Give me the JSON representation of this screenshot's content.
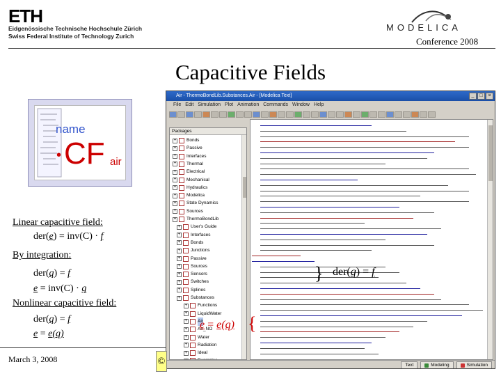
{
  "header": {
    "eth_logo_text": "ETH",
    "eth_line1": "Eidgenössische Technische Hochschule Zürich",
    "eth_line2": "Swiss Federal Institute of Technology Zurich",
    "modelica_logo_text": "MODELICA",
    "conference": "Conference 2008"
  },
  "slide": {
    "title": "Capacitive Fields",
    "date": "March 3, 2008",
    "copyright_glyph": "©"
  },
  "cf_icon": {
    "name_label": "name",
    "bullet": "•",
    "main": "CF",
    "subscript": "air"
  },
  "left_text": {
    "linear_heading": "Linear capacitive field:",
    "linear_eq_prefix": "der(",
    "linear_eq_var": "e",
    "linear_eq_mid": ") = inv(C) · ",
    "linear_eq_f": "f",
    "integration_heading": "By integration:",
    "int_eq1_prefix": "der(",
    "int_eq1_var": "q",
    "int_eq1_mid": ") = ",
    "int_eq1_f": "f",
    "int_eq2_e": "e",
    "int_eq2_mid": " = inv(C) · ",
    "int_eq2_q": "q",
    "nonlinear_heading": "Nonlinear capacitive field:",
    "nl_eq1_prefix": "der(",
    "nl_eq1_var": "q",
    "nl_eq1_mid": ") = ",
    "nl_eq1_f": "f",
    "nl_eq2_e": "e",
    "nl_eq2_mid": " = ",
    "nl_eq2_fn": "e(q)"
  },
  "overlay": {
    "brace_right": "}",
    "right_eq_prefix": "der(",
    "right_eq_var": "q",
    "right_eq_mid": ") = ",
    "right_eq_f": "f",
    "red_eq_e": "e",
    "red_eq_mid": " = ",
    "red_eq_fn": "e(q)",
    "brace_left": "{"
  },
  "window": {
    "title": "Air - ThermoBondLib.Substances.Air - [Modelica Text]",
    "buttons": [
      "_",
      "□",
      "×"
    ],
    "menu": [
      "File",
      "Edit",
      "Simulation",
      "Plot",
      "Animation",
      "Commands",
      "Window",
      "Help"
    ],
    "packages_header": "Packages",
    "packages": [
      {
        "label": "Bonds",
        "selected": false
      },
      {
        "label": "Passive",
        "selected": false
      },
      {
        "label": "Interfaces",
        "selected": false
      },
      {
        "label": "Thermal",
        "selected": false
      },
      {
        "label": "Electrical",
        "selected": false
      },
      {
        "label": "Mechanical",
        "selected": false
      },
      {
        "label": "Hydraulics",
        "selected": false
      },
      {
        "label": "Modelica",
        "selected": false
      },
      {
        "label": "State Dynamics",
        "selected": false
      },
      {
        "label": "Sources",
        "selected": false
      },
      {
        "label": "ThermoBondLib",
        "selected": false
      },
      {
        "label": "User's Guide",
        "selected": false
      },
      {
        "label": "Interfaces",
        "selected": false
      },
      {
        "label": "Bonds",
        "selected": false
      },
      {
        "label": "Junctions",
        "selected": false
      },
      {
        "label": "Passive",
        "selected": false
      },
      {
        "label": "Sources",
        "selected": false
      },
      {
        "label": "Sensors",
        "selected": false
      },
      {
        "label": "Switches",
        "selected": false
      },
      {
        "label": "Splines",
        "selected": false
      },
      {
        "label": "Substances",
        "selected": false
      },
      {
        "label": "Functions",
        "selected": false
      },
      {
        "label": "LiquidWater",
        "selected": false
      },
      {
        "label": "Air",
        "selected": true
      },
      {
        "label": "Air_NO",
        "selected": false
      },
      {
        "label": "Water",
        "selected": false
      },
      {
        "label": "Radiation",
        "selected": false
      },
      {
        "label": "Ideal",
        "selected": false
      },
      {
        "label": "Examples",
        "selected": false
      }
    ],
    "status_buttons": [
      "Text",
      "Modeling",
      "Simulation"
    ]
  }
}
